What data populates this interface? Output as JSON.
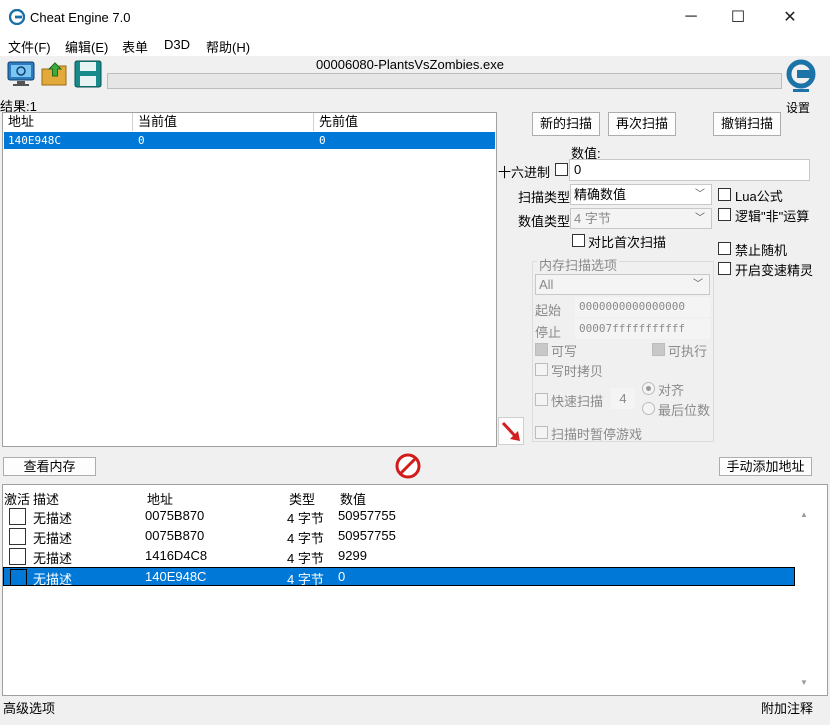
{
  "window": {
    "title": "Cheat Engine 7.0",
    "minimize": "─",
    "maximize": "☐",
    "close": "✕"
  },
  "menu": [
    "文件(F)",
    "编辑(E)",
    "表单",
    "D3D",
    "帮助(H)"
  ],
  "toolbar": {
    "process_title": "00006080-PlantsVsZombies.exe",
    "settings_label": "设置",
    "icons": [
      "open-process-icon",
      "open-file-icon",
      "save-icon",
      "cheat-engine-logo-icon"
    ]
  },
  "results": {
    "count_label": "结果:1",
    "headers": [
      "地址",
      "当前值",
      "先前值"
    ],
    "rows": [
      {
        "address": "140E948C",
        "current": "0",
        "previous": "0"
      }
    ]
  },
  "scan": {
    "new_scan": "新的扫描",
    "next_scan": "再次扫描",
    "undo_scan": "撤销扫描",
    "value_label": "数值:",
    "hex_label": "十六进制",
    "value": "0",
    "scan_type_label": "扫描类型",
    "scan_type": "精确数值",
    "value_type_label": "数值类型",
    "value_type": "4 字节",
    "compare_first": "对比首次扫描",
    "lua_formula": "Lua公式",
    "logic_not": "逻辑\"非\"运算",
    "no_random": "禁止随机",
    "speedhack": "开启变速精灵"
  },
  "memory_options": {
    "title": "内存扫描选项",
    "region": "All",
    "start_label": "起始",
    "start": "0000000000000000",
    "stop_label": "停止",
    "stop": "00007fffffffffff",
    "writable": "可写",
    "executable": "可执行",
    "copy_on_write": "写时拷贝",
    "fast_scan": "快速扫描",
    "fast_scan_value": "4",
    "alignment": "对齐",
    "last_digits": "最后位数",
    "pause_game": "扫描时暂停游戏"
  },
  "actions": {
    "view_memory": "查看内存",
    "add_manual": "手动添加地址"
  },
  "address_list": {
    "headers": [
      "激活",
      "描述",
      "地址",
      "类型",
      "数值"
    ],
    "rows": [
      {
        "description": "无描述",
        "address": "0075B870",
        "type": "4 字节",
        "value": "50957755"
      },
      {
        "description": "无描述",
        "address": "0075B870",
        "type": "4 字节",
        "value": "50957755"
      },
      {
        "description": "无描述",
        "address": "1416D4C8",
        "type": "4 字节",
        "value": "9299"
      },
      {
        "description": "无描述",
        "address": "140E948C",
        "type": "4 字节",
        "value": "0"
      }
    ],
    "selected_row": 3
  },
  "status": {
    "advanced": "高级选项",
    "comments": "附加注释"
  },
  "colors": {
    "selection": "#0078d7",
    "arrow": "#d02020"
  }
}
